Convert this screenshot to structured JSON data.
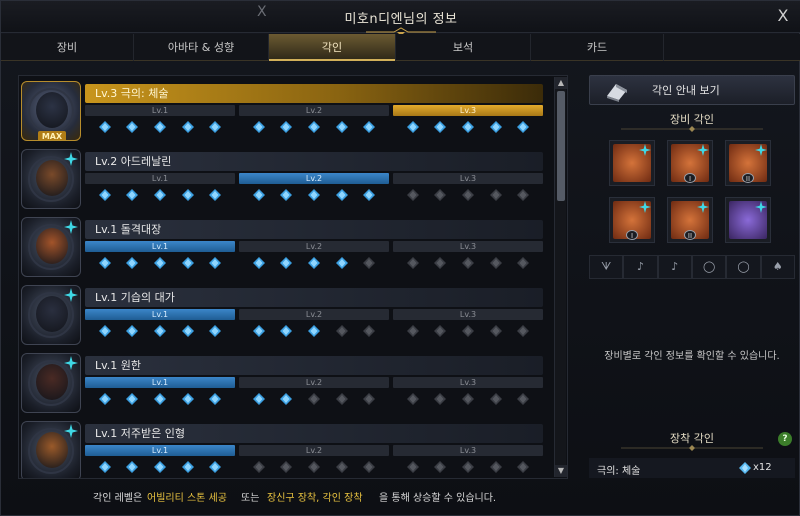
{
  "window": {
    "title": "미호n디엔님의 정보",
    "close_label": "X",
    "ghost_close_label": "X"
  },
  "tabs": [
    {
      "label": "장비"
    },
    {
      "label": "아바타 & 성향"
    },
    {
      "label": "각인",
      "active": true
    },
    {
      "label": "보석"
    },
    {
      "label": "카드"
    }
  ],
  "engravings": [
    {
      "title": "Lv.3 극의: 체술",
      "level": 3,
      "max_badge": "MAX",
      "lv_labels": [
        "Lv.1",
        "Lv.2",
        "Lv.3"
      ],
      "gems_filled": 15
    },
    {
      "title": "Lv.2 아드레날린",
      "level": 2,
      "lv_labels": [
        "Lv.1",
        "Lv.2",
        "Lv.3"
      ],
      "gems_filled": 10
    },
    {
      "title": "Lv.1 돌격대장",
      "level": 1,
      "lv_labels": [
        "Lv.1",
        "Lv.2",
        "Lv.3"
      ],
      "gems_filled": 9
    },
    {
      "title": "Lv.1 기습의 대가",
      "level": 1,
      "lv_labels": [
        "Lv.1",
        "Lv.2",
        "Lv.3"
      ],
      "gems_filled": 8
    },
    {
      "title": "Lv.1 원한",
      "level": 1,
      "lv_labels": [
        "Lv.1",
        "Lv.2",
        "Lv.3"
      ],
      "gems_filled": 7
    },
    {
      "title": "Lv.1 저주받은 인형",
      "level": 1,
      "lv_labels": [
        "Lv.1",
        "Lv.2",
        "Lv.3"
      ],
      "gems_filled": 5
    }
  ],
  "scroll": {
    "up": "▲",
    "down": "▼"
  },
  "right": {
    "guide_button": "각인 안내 보기",
    "equip_section": "장비 각인",
    "equip_hint": "장비별로 각인 정보를 확인할 수 있습니다.",
    "mount_section": "장착 각인",
    "help_label": "?",
    "mount_name": "극의: 체술",
    "mount_count": "x12"
  },
  "footer": {
    "p1": "각인 레벨은",
    "p2": "어빌리티 스톤 세공",
    "p3": "또는",
    "p4": "장신구 장착, 각인 장착",
    "p5": "을 통해 상승할 수 있습니다."
  },
  "colors": {
    "accent_gold": "#e8c23f",
    "level_blue": "#2f78b8",
    "gem_blue": "#58b8f0"
  }
}
